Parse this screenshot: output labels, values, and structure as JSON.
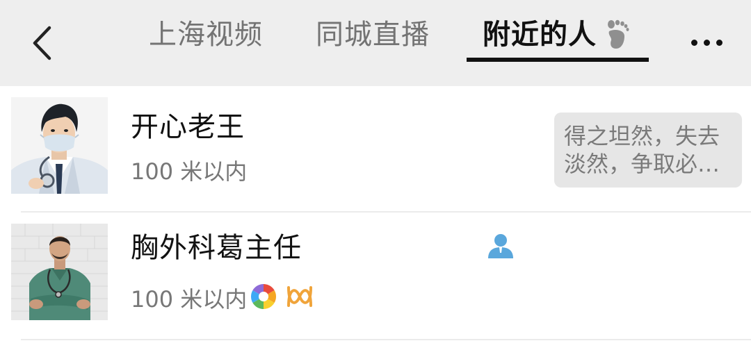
{
  "header": {
    "back_icon": "chevron-left-icon",
    "tabs": [
      {
        "label": "上海视频",
        "active": false
      },
      {
        "label": "同城直播",
        "active": false
      },
      {
        "label": "附近的人",
        "active": true
      }
    ],
    "active_tab_icon": "footprint-icon",
    "more_icon": "more-dots-icon"
  },
  "people": [
    {
      "name": "开心老王",
      "distance": "100 米以内",
      "avatar": "doctor-illustration-avatar",
      "signature_lines": [
        "得之坦然，失去",
        "淡然，争取必…"
      ]
    },
    {
      "name": "胸外科葛主任",
      "distance": "100 米以内",
      "avatar": "doctor-photo-avatar",
      "badge_icon": "person-icon",
      "extra_icons": [
        "camera-aperture-icon",
        "wave-icon"
      ]
    }
  ],
  "colors": {
    "header_bg": "#eeeeee",
    "active_tab": "#111111",
    "inactive_tab": "#737373",
    "badge_blue": "#5aa7dc",
    "signature_bg": "#e6e6e6"
  }
}
